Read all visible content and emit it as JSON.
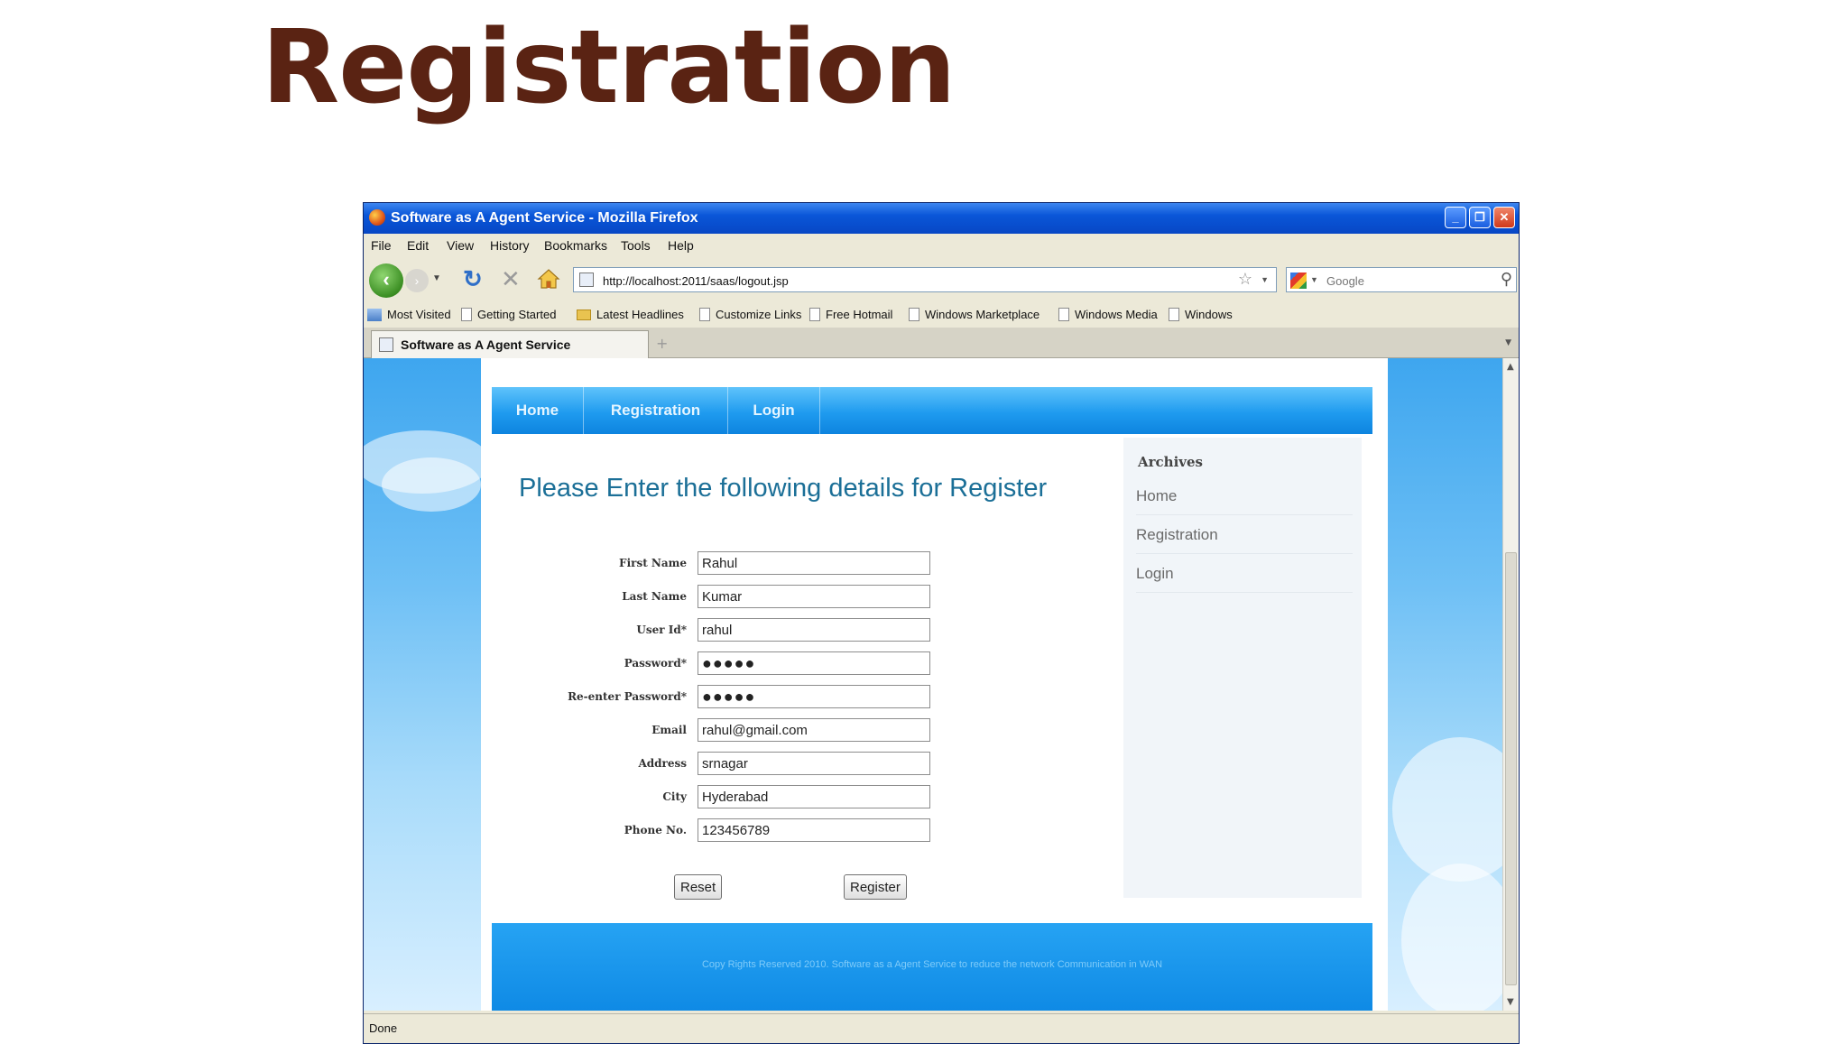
{
  "slide": {
    "title": "Registration"
  },
  "window": {
    "title": "Software as A Agent Service - Mozilla Firefox"
  },
  "menu": [
    "File",
    "Edit",
    "View",
    "History",
    "Bookmarks",
    "Tools",
    "Help"
  ],
  "toolbar": {
    "url": "http://localhost:2011/saas/logout.jsp",
    "search_placeholder": "Google"
  },
  "bookmarks": [
    "Most Visited",
    "Getting Started",
    "Latest Headlines",
    "Customize Links",
    "Free Hotmail",
    "Windows Marketplace",
    "Windows Media",
    "Windows"
  ],
  "tab": {
    "label": "Software as A Agent Service",
    "new_tab": "+"
  },
  "site": {
    "nav": [
      "Home",
      "Registration",
      "Login"
    ],
    "heading": "Please Enter the following details for Register",
    "form": {
      "fields": [
        {
          "label": "First Name",
          "value": "Rahul"
        },
        {
          "label": "Last Name",
          "value": "Kumar"
        },
        {
          "label": "User Id*",
          "value": "rahul"
        },
        {
          "label": "Password*",
          "value": "●●●●●"
        },
        {
          "label": "Re-enter Password*",
          "value": "●●●●●"
        },
        {
          "label": "Email",
          "value": "rahul@gmail.com"
        },
        {
          "label": "Address",
          "value": "srnagar"
        },
        {
          "label": "City",
          "value": "Hyderabad"
        },
        {
          "label": "Phone No.",
          "value": "123456789"
        }
      ],
      "reset_label": "Reset",
      "register_label": "Register"
    },
    "sidebar": {
      "title": "Archives",
      "links": [
        "Home",
        "Registration",
        "Login"
      ]
    },
    "footer": "Copy Rights Reserved 2010. Software as a Agent Service to reduce the network Communication in WAN"
  },
  "status": "Done"
}
